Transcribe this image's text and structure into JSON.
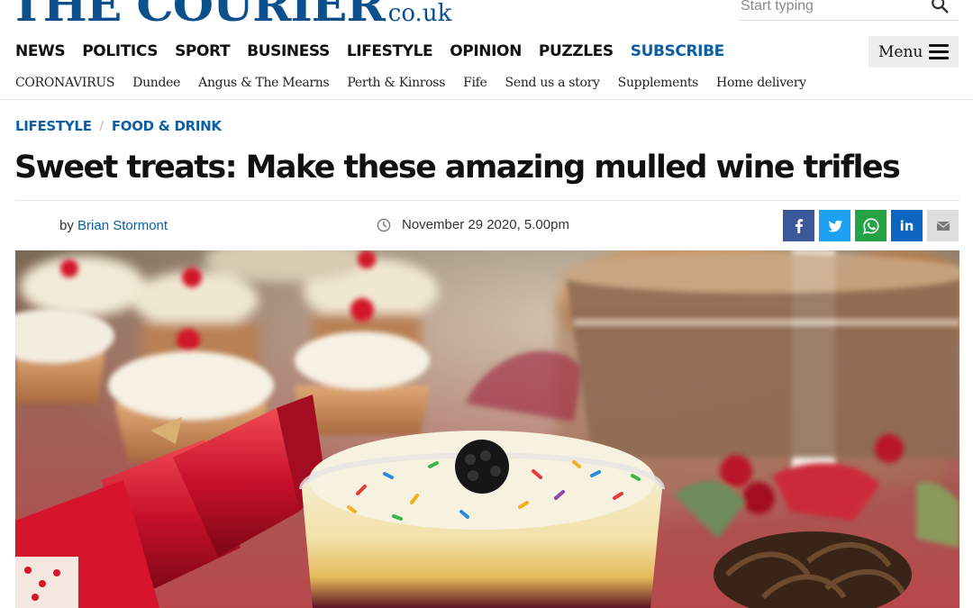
{
  "masthead": {
    "logo_main": "THE COURIER",
    "logo_suffix": ".co.uk",
    "search_placeholder": "Start typing"
  },
  "primary_nav": [
    "NEWS",
    "POLITICS",
    "SPORT",
    "BUSINESS",
    "LIFESTYLE",
    "OPINION",
    "PUZZLES",
    "SUBSCRIBE"
  ],
  "menu": {
    "label": "Menu"
  },
  "secondary_nav": [
    "CORONAVIRUS",
    "Dundee",
    "Angus & The Mearns",
    "Perth & Kinross",
    "Fife",
    "Send us a story",
    "Supplements",
    "Home delivery"
  ],
  "article": {
    "breadcrumb": [
      "LIFESTYLE",
      "FOOD & DRINK"
    ],
    "headline": "Sweet treats: Make these amazing mulled wine trifles",
    "byline_prefix": "by",
    "author": "Brian Stormont",
    "timestamp": "November 29 2020, 5.00pm"
  },
  "share_buttons": [
    {
      "network": "facebook",
      "icon": "facebook-icon",
      "color": "#3b5998"
    },
    {
      "network": "twitter",
      "icon": "twitter-icon",
      "color": "#1da1f2"
    },
    {
      "network": "whatsapp",
      "icon": "whatsapp-icon",
      "color": "#25a244"
    },
    {
      "network": "linkedin",
      "icon": "linkedin-icon",
      "label": "in",
      "color": "#0a66c2"
    },
    {
      "network": "email",
      "icon": "email-icon",
      "color": "#dedede"
    }
  ],
  "theme": {
    "brand": "#0b4f8c",
    "link": "#0b5fa5"
  }
}
